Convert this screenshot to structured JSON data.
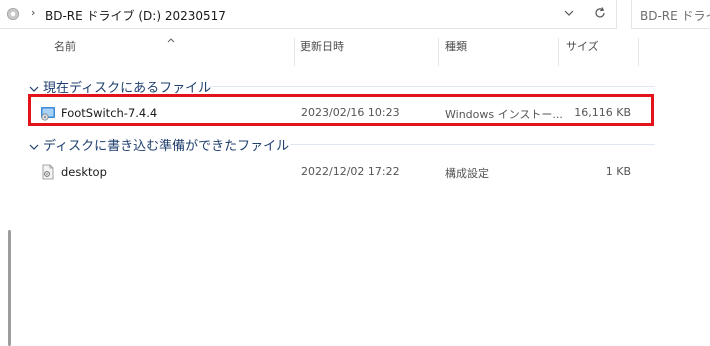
{
  "address_bar": {
    "path": "BD-RE ドライブ (D:) 20230517",
    "search_placeholder": "BD-RE ドライブ"
  },
  "columns": {
    "name": "名前",
    "modified": "更新日時",
    "type": "種類",
    "size": "サイズ"
  },
  "groups": [
    {
      "title": "現在ディスクにあるファイル",
      "files": [
        {
          "name": "FootSwitch-7.4.4",
          "modified": "2023/02/16 10:23",
          "type": "Windows インストー...",
          "size": "16,116 KB",
          "icon": "installer-icon"
        }
      ]
    },
    {
      "title": "ディスクに書き込む準備ができたファイル",
      "files": [
        {
          "name": "desktop",
          "modified": "2022/12/02 17:22",
          "type": "構成設定",
          "size": "1 KB",
          "icon": "settings-file-icon"
        }
      ]
    }
  ],
  "highlight_color": "#e3131c"
}
